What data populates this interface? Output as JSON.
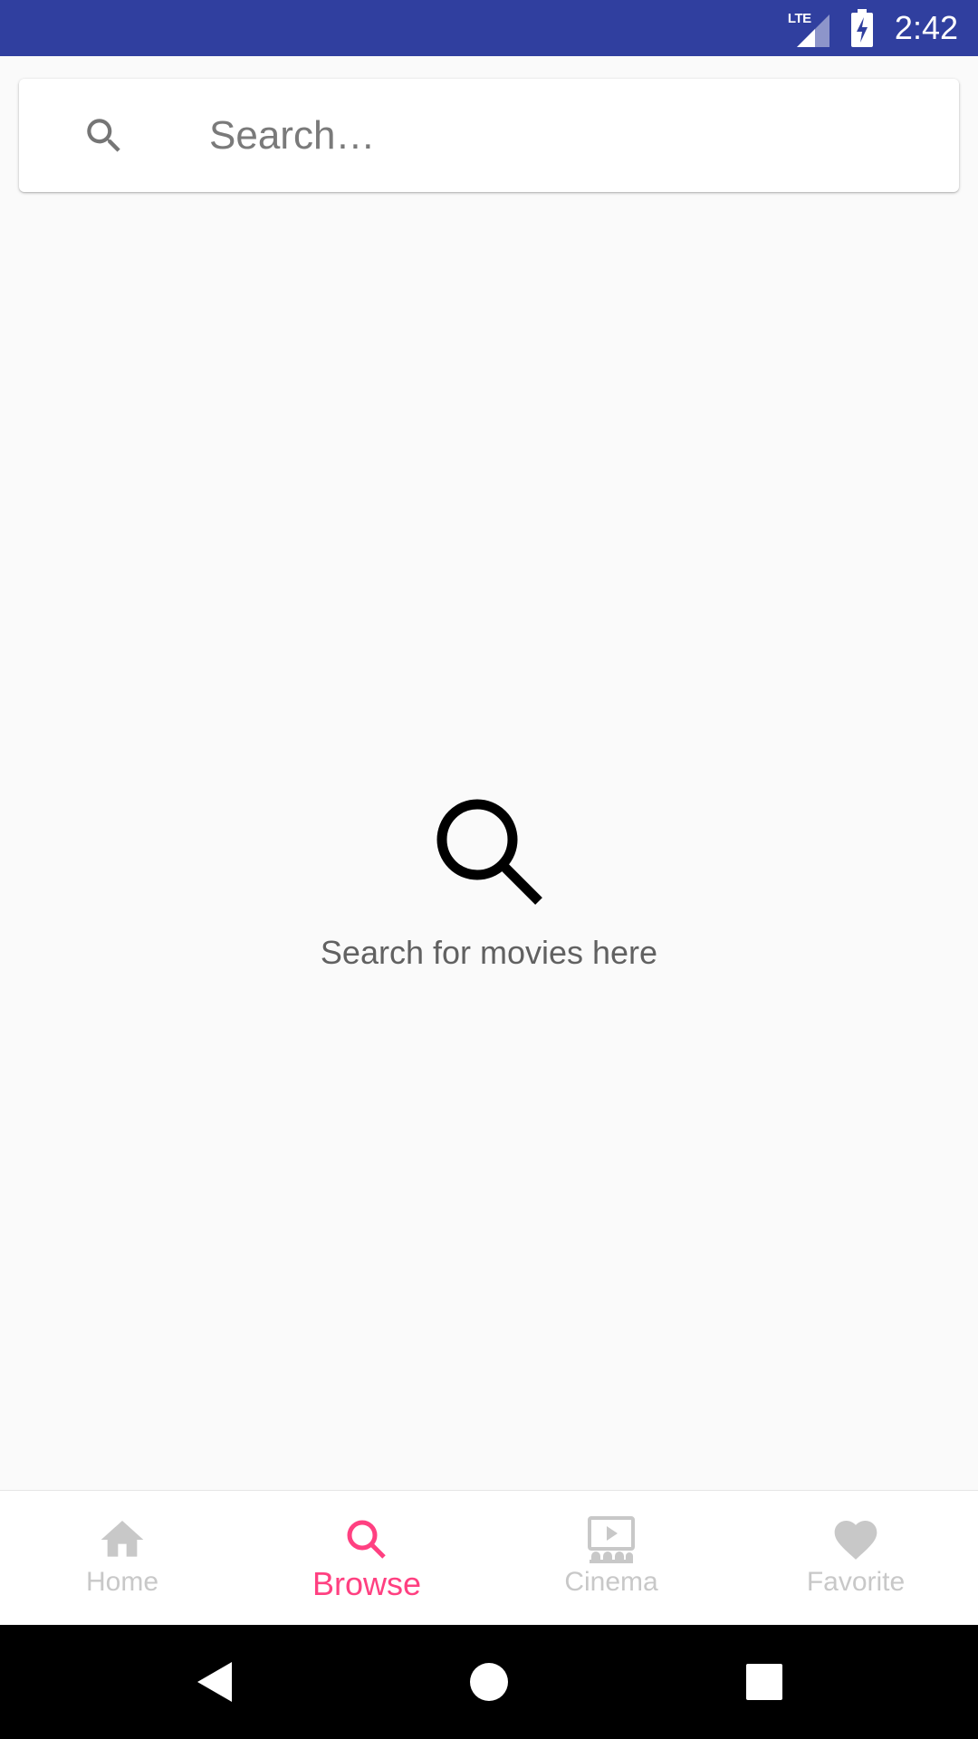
{
  "status_bar": {
    "network": "LTE",
    "time": "2:42"
  },
  "search": {
    "placeholder": "Search…",
    "value": ""
  },
  "empty_state": {
    "message": "Search for movies here"
  },
  "bottom_nav": {
    "items": [
      {
        "label": "Home",
        "icon": "home-icon",
        "active": false
      },
      {
        "label": "Browse",
        "icon": "search-icon",
        "active": true
      },
      {
        "label": "Cinema",
        "icon": "cinema-icon",
        "active": false
      },
      {
        "label": "Favorite",
        "icon": "heart-icon",
        "active": false
      }
    ],
    "active_color": "#ff4081",
    "inactive_color": "#c8c8c8"
  },
  "colors": {
    "status_bar": "#303f9f",
    "background": "#fafafa"
  }
}
